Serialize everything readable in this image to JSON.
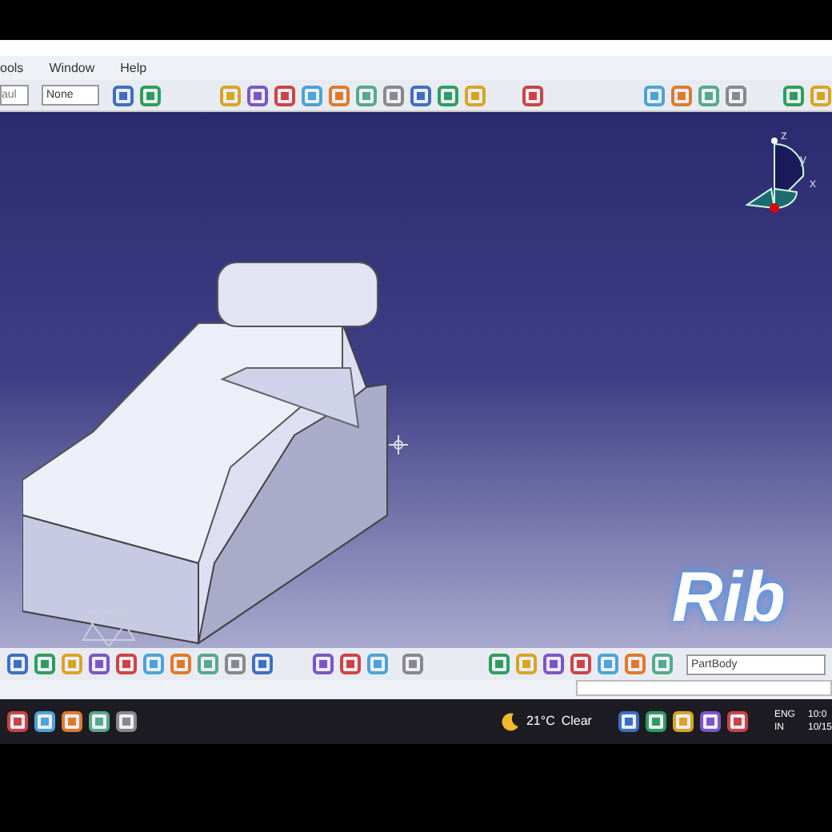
{
  "menu_bar": {
    "items": [
      "ools",
      "Window",
      "Help"
    ]
  },
  "toolbar": {
    "combo_1": "aul",
    "combo_2": "None"
  },
  "compass": {
    "labels": [
      "z",
      "y",
      "x"
    ]
  },
  "caption": "Rib",
  "bottom_toolbar": {
    "body_field": "PartBody"
  },
  "taskbar": {
    "weather_temp": "21°C",
    "weather_text": "Clear",
    "language": "ENG",
    "region": "IN",
    "time": "10:0",
    "date": "10/15"
  }
}
